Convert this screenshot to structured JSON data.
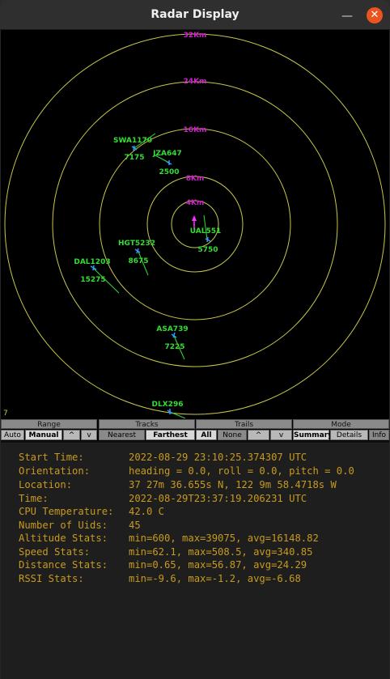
{
  "window": {
    "title": "Radar Display"
  },
  "radar": {
    "range_labels": [
      "32Km",
      "24Km",
      "16Km",
      "8Km",
      "4Km"
    ],
    "corner_count": "7",
    "colors": {
      "rings": "#c8c84a",
      "range_label": "#d020d0",
      "track_label": "#33dd33",
      "aircraft": "#3399ff",
      "own_ship": "#ff33ff"
    },
    "tracks": [
      {
        "callsign": "SWA1170",
        "altitude": "7175"
      },
      {
        "callsign": "JZA647",
        "altitude": "2500"
      },
      {
        "callsign": "UAL551",
        "altitude": "5750"
      },
      {
        "callsign": "HGT5232",
        "altitude": "8675"
      },
      {
        "callsign": "DAL1203",
        "altitude": "15275"
      },
      {
        "callsign": "ASA739",
        "altitude": "7225"
      },
      {
        "callsign": "DLX296",
        "altitude": ""
      }
    ]
  },
  "controls": {
    "range": {
      "title": "Range",
      "auto": "Auto",
      "manual": "Manual",
      "up": "^",
      "down": "v"
    },
    "tracks": {
      "title": "Tracks",
      "nearest": "Nearest",
      "farthest": "Farthest"
    },
    "trails": {
      "title": "Trails",
      "all": "All",
      "none": "None",
      "up": "^",
      "down": "v"
    },
    "mode": {
      "title": "Mode",
      "summary": "Summary",
      "details": "Details",
      "info": "Info"
    }
  },
  "stats": [
    {
      "label": "Start Time:",
      "value": "2022-08-29 23:10:25.374307 UTC"
    },
    {
      "label": "Orientation:",
      "value": "heading = 0.0, roll = 0.0, pitch = 0.0"
    },
    {
      "label": "Location:",
      "value": "37 27m 36.655s N, 122 9m 58.4718s W"
    },
    {
      "label": "Time:",
      "value": "2022-08-29T23:37:19.206231 UTC"
    },
    {
      "label": "CPU Temperature:",
      "value": "42.0 C"
    },
    {
      "label": "Number of Uids:",
      "value": "45"
    },
    {
      "label": "Altitude Stats:",
      "value": "min=600, max=39075, avg=16148.82"
    },
    {
      "label": "Speed Stats:",
      "value": "min=62.1, max=508.5, avg=340.85"
    },
    {
      "label": "Distance Stats:",
      "value": "min=0.65, max=56.87, avg=24.29"
    },
    {
      "label": "RSSI Stats:",
      "value": "min=-9.6, max=-1.2, avg=-6.68"
    }
  ]
}
